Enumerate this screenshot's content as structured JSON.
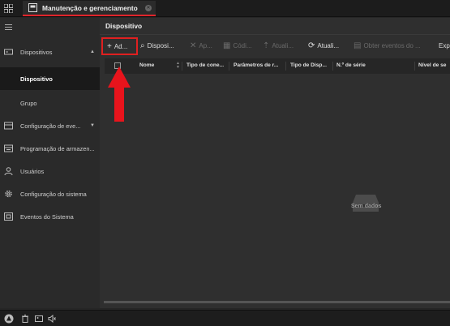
{
  "tab": {
    "title": "Manutenção e gerenciamento"
  },
  "sidebar": {
    "items": [
      {
        "label": "Dispositivos",
        "icon": "device-icon",
        "arrow": "▲"
      },
      {
        "label": "Dispositivo",
        "active": true
      },
      {
        "label": "Grupo"
      },
      {
        "label": "Configuração de eve...",
        "icon": "event-config-icon",
        "arrow": "▼"
      },
      {
        "label": "Programação de armazen...",
        "icon": "storage-icon"
      },
      {
        "label": "Usuários",
        "icon": "user-icon"
      },
      {
        "label": "Configuração do sistema",
        "icon": "gear-icon"
      },
      {
        "label": "Eventos do Sistema",
        "icon": "system-event-icon"
      }
    ]
  },
  "main": {
    "title": "Dispositivo",
    "toolbar": {
      "add": "Ad...",
      "online": "Disposi...",
      "delete": "Ap...",
      "qr": "Códi...",
      "upgrade": "Atuali...",
      "refresh": "Atuali...",
      "events": "Obter eventos do ...",
      "export": "Expo"
    },
    "columns": [
      "Nome",
      "Tipo de cone...",
      "Parâmetros de r...",
      "Tipo de Disp...",
      "N.º de série",
      "Nível de se"
    ],
    "empty_text": "Sem dados"
  },
  "colors": {
    "accent": "#e0252b",
    "arrow": "#e8141c"
  }
}
